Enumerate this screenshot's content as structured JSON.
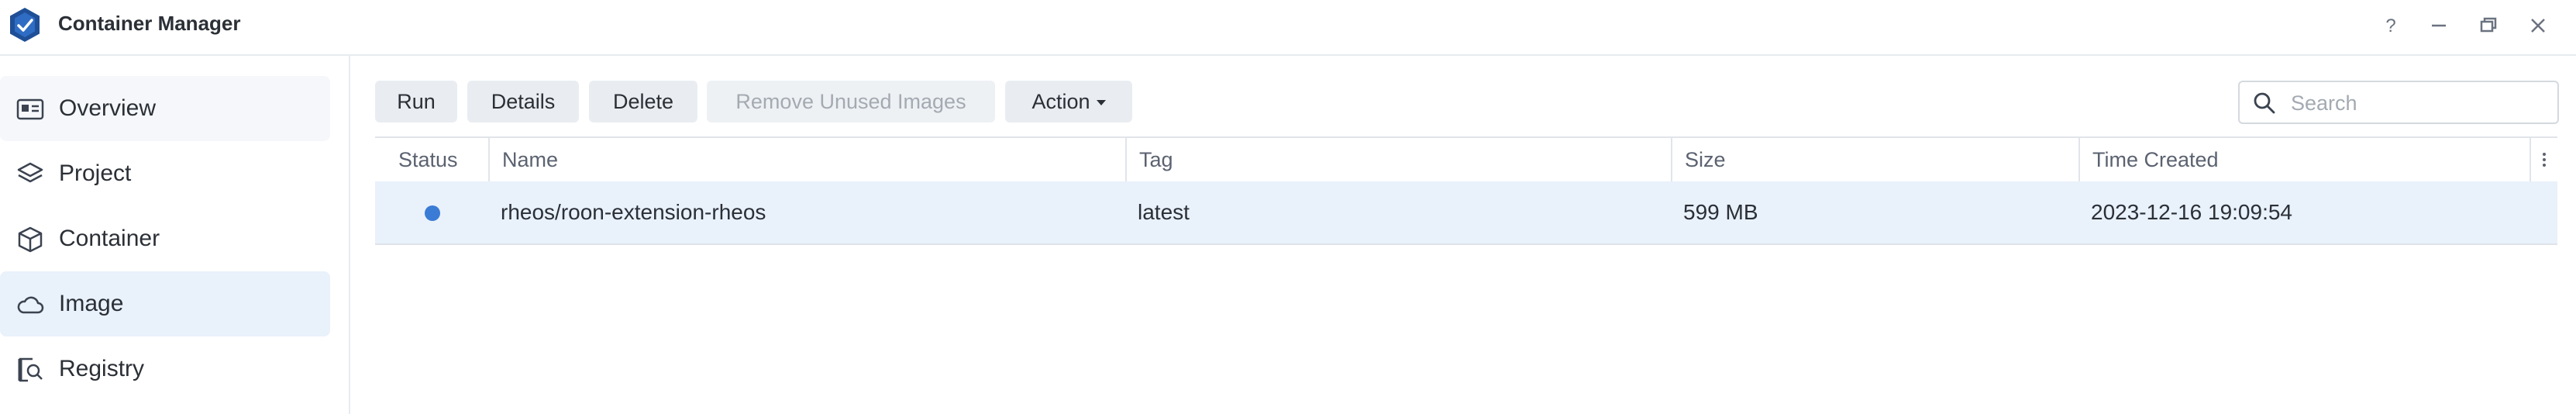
{
  "app": {
    "title": "Container Manager"
  },
  "window_controls": {
    "help": "help-icon",
    "minimize": "minimize-icon",
    "restore": "restore-icon",
    "close": "close-icon"
  },
  "sidebar": {
    "items": [
      {
        "label": "Overview",
        "icon": "overview-card-icon"
      },
      {
        "label": "Project",
        "icon": "layers-icon"
      },
      {
        "label": "Container",
        "icon": "cube-icon"
      },
      {
        "label": "Image",
        "icon": "cloud-icon"
      },
      {
        "label": "Registry",
        "icon": "registry-search-icon"
      }
    ],
    "active": "Image"
  },
  "toolbar": {
    "run": "Run",
    "details": "Details",
    "delete": "Delete",
    "remove_unused": "Remove Unused Images",
    "action": "Action"
  },
  "search": {
    "placeholder": "Search"
  },
  "table": {
    "columns": [
      "Status",
      "Name",
      "Tag",
      "Size",
      "Time Created"
    ],
    "rows": [
      {
        "status": "running",
        "name": "rheos/roon-extension-rheos",
        "tag": "latest",
        "size": "599 MB",
        "created": "2023-12-16 19:09:54"
      }
    ]
  },
  "colors": {
    "accent": "#3a7bd5",
    "selected_row": "#e9f1fb",
    "status_dot": "#3a7bd5"
  }
}
